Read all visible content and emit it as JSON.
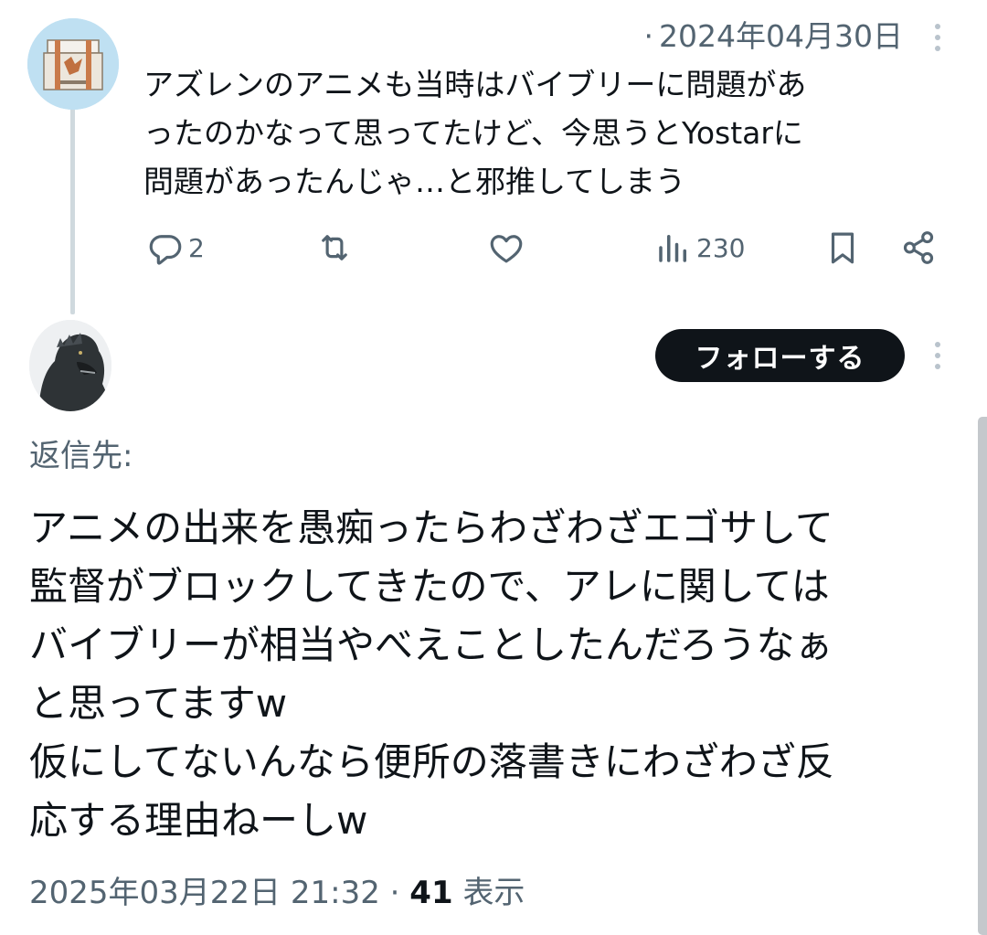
{
  "first_post": {
    "date": "2024年04月30日",
    "separator": "·",
    "text": "アズレンのアニメも当時はバイブリーに問題があ\nったのかなって思ってたけど、今思うとYostarに\n問題があったんじゃ…と邪推してしまう",
    "actions": {
      "reply_count": "2",
      "retweet_count": "",
      "like_count": "",
      "views_count": "230"
    },
    "icons": [
      "reply-icon",
      "retweet-icon",
      "like-icon",
      "views-icon",
      "bookmark-icon",
      "share-icon",
      "more-icon"
    ]
  },
  "second_post": {
    "follow_label": "フォローする",
    "reply_to_label": "返信先:",
    "text": "アニメの出来を愚痴ったらわざわざエゴサして\n監督がブロックしてきたので、アレに関しては\nバイブリーが相当やべえことしたんだろうなぁ\nと思ってますw\n仮にしてないんなら便所の落書きにわざわざ反\n応する理由ねーしw",
    "timestamp": "2025年03月22日 21:32",
    "separator": "·",
    "views_count": "41",
    "views_label": "表示"
  },
  "colors": {
    "text_primary": "#0f1419",
    "text_secondary": "#536471",
    "thread_line": "#cfd9de",
    "follow_button_bg": "#0f1419",
    "follow_button_text": "#ffffff"
  }
}
